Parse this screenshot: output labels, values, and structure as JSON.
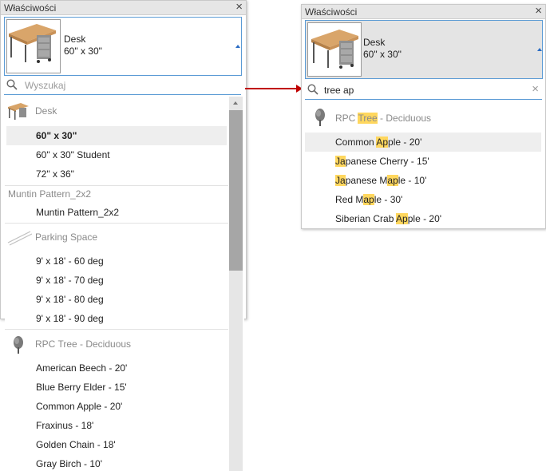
{
  "left_panel": {
    "title": "Właściwości",
    "type_name": "Desk",
    "type_size": "60\" x 30\"",
    "search_placeholder": "Wyszukaj",
    "groups": [
      {
        "family": "Desk",
        "items": [
          "60\" x 30\"",
          "60\" x 30\" Student",
          "72\" x 36\""
        ]
      },
      {
        "family": "Muntin Pattern_2x2",
        "items": [
          "Muntin Pattern_2x2"
        ]
      },
      {
        "family": "Parking Space",
        "items": [
          "9' x 18' - 60 deg",
          "9' x 18' - 70 deg",
          "9' x 18' - 80 deg",
          "9' x 18' - 90 deg"
        ]
      },
      {
        "family": "RPC Tree - Deciduous",
        "items": [
          "American Beech - 20'",
          "Blue Berry Elder - 15'",
          "Common Apple - 20'",
          "Fraxinus - 18'",
          "Golden Chain - 18'",
          "Gray Birch - 10'"
        ]
      }
    ],
    "selected_item": "60\" x 30\""
  },
  "right_panel": {
    "title": "Właściwości",
    "type_name": "Desk",
    "type_size": "60\" x 30\"",
    "search_value": "tree ap",
    "family_pre": "RPC ",
    "family_hl": "Tree",
    "family_post": " - Deciduous",
    "results": [
      [
        {
          "t": "Common "
        },
        {
          "t": "Ap",
          "h": true
        },
        {
          "t": "ple - 20'"
        }
      ],
      [
        {
          "t": "Ja",
          "h": true
        },
        {
          "t": "panese Cherry - 15'"
        }
      ],
      [
        {
          "t": "Ja",
          "h": true
        },
        {
          "t": "panese M"
        },
        {
          "t": "ap",
          "h": true
        },
        {
          "t": "le - 10'"
        }
      ],
      [
        {
          "t": "Red M"
        },
        {
          "t": "ap",
          "h": true
        },
        {
          "t": "le - 30'"
        }
      ],
      [
        {
          "t": "Siberian Crab "
        },
        {
          "t": "Ap",
          "h": true
        },
        {
          "t": "ple - 20'"
        }
      ]
    ]
  },
  "icons": {
    "close": "close-icon",
    "search": "search-icon",
    "clear": "clear-search-icon",
    "dropdown": "dropdown-arrow-icon",
    "arrow": "red-arrow-icon"
  },
  "colors": {
    "accent": "#5b9bd5",
    "highlight": "#ffd75e",
    "arrow": "#c00000"
  }
}
